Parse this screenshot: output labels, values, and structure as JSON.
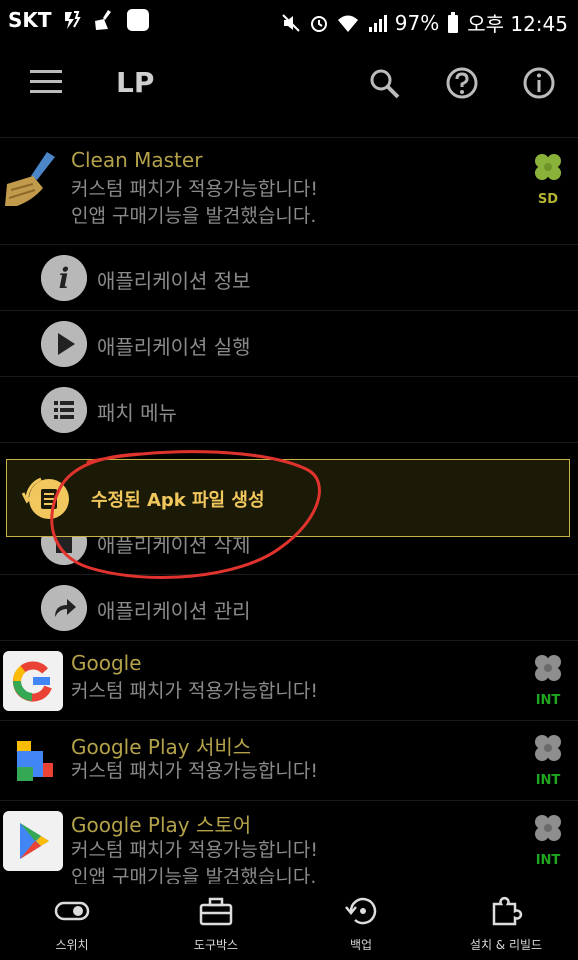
{
  "status_bar": {
    "carrier": "SKT",
    "battery": "97%",
    "time": "오후 12:45"
  },
  "app_bar": {
    "title": "LP"
  },
  "apps": [
    {
      "name": "Clean Master",
      "line1": "커스텀 패치가 적용가능합니다!",
      "line2": "인앱 구매기능을 발견했습니다.",
      "tag": "SD",
      "tag_color": "#b4b432"
    },
    {
      "name": "Google",
      "line1": "커스텀 패치가 적용가능합니다!",
      "tag": "INT",
      "tag_color": "#1fa51f"
    },
    {
      "name": "Google Play 서비스",
      "line1": "커스텀 패치가 적용가능합니다!",
      "tag": "INT",
      "tag_color": "#1fa51f"
    },
    {
      "name": "Google Play 스토어",
      "line1": "커스텀 패치가 적용가능합니다!",
      "line2": "인앱 구매기능을 발견했습니다.",
      "tag": "INT",
      "tag_color": "#1fa51f"
    }
  ],
  "menu": [
    {
      "label": "애플리케이션 정보",
      "icon": "info-icon"
    },
    {
      "label": "애플리케이션 실행",
      "icon": "play-icon"
    },
    {
      "label": "패치 메뉴",
      "icon": "list-icon"
    },
    {
      "label": "애플리케이션 삭제",
      "icon": "trash-icon"
    },
    {
      "label": "애플리케이션 관리",
      "icon": "share-arrow-icon"
    }
  ],
  "popup": {
    "label": "수정된 Apk 파일 생성",
    "icon": "rebuild-apk-icon"
  },
  "bottom_nav": [
    {
      "label": "스위치",
      "icon": "toggle-icon"
    },
    {
      "label": "도구박스",
      "icon": "toolbox-icon"
    },
    {
      "label": "백업",
      "icon": "backup-icon"
    },
    {
      "label": "설치 & 리빌드",
      "icon": "puzzle-icon"
    }
  ],
  "colors": {
    "accent": "#f2c85e",
    "app_name": "#b4a24a",
    "annotation": "#e0332e"
  }
}
